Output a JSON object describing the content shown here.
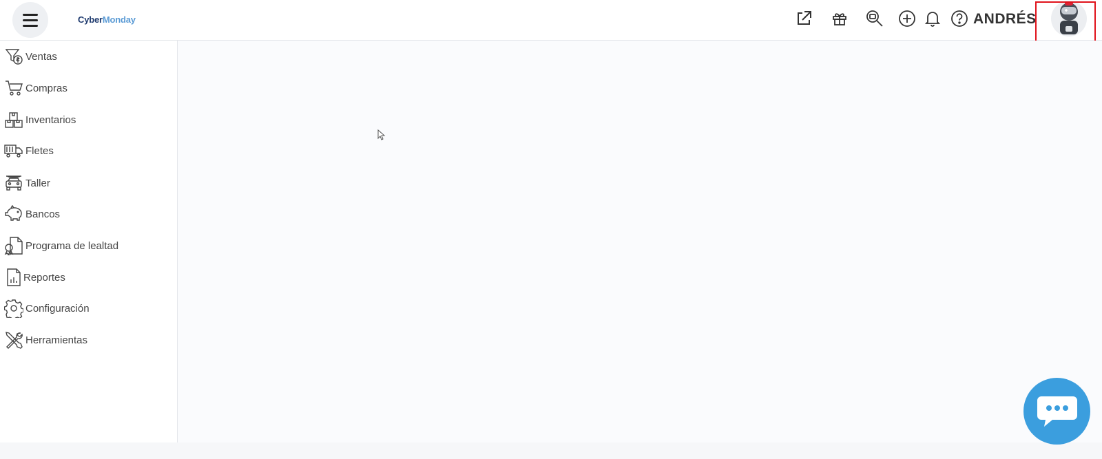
{
  "header": {
    "logo_part1": "Cyber",
    "logo_part2": "Monday",
    "user_name": "ANDRÉS",
    "icons": [
      "external-link-icon",
      "gift-icon",
      "search-zoom-icon",
      "add-circle-icon",
      "bell-icon",
      "help-icon"
    ]
  },
  "sidebar": {
    "items": [
      {
        "label": "Ventas",
        "icon": "sales-funnel-icon"
      },
      {
        "label": "Compras",
        "icon": "shopping-cart-icon"
      },
      {
        "label": "Inventarios",
        "icon": "boxes-icon"
      },
      {
        "label": "Fletes",
        "icon": "truck-icon"
      },
      {
        "label": "Taller",
        "icon": "car-icon"
      },
      {
        "label": "Bancos",
        "icon": "piggy-bank-icon"
      },
      {
        "label": "Programa de lealtad",
        "icon": "loyalty-icon"
      },
      {
        "label": "Reportes",
        "icon": "report-icon"
      },
      {
        "label": "Configuración",
        "icon": "gear-icon"
      },
      {
        "label": "Herramientas",
        "icon": "tools-icon"
      }
    ]
  },
  "colors": {
    "accent": "#3b9ede",
    "logo_dark": "#1e3a6e",
    "logo_light": "#5b9bd5",
    "highlight": "#e0121b"
  }
}
